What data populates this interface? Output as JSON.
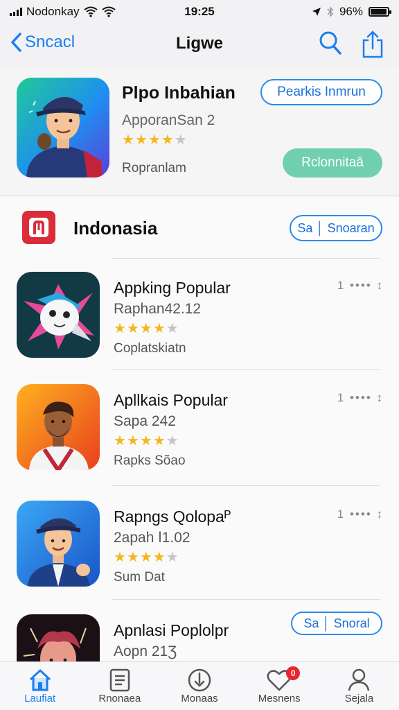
{
  "status_bar": {
    "carrier": "Nodonkay",
    "time": "19:25",
    "battery": "96%",
    "battery_level": 0.96,
    "icons": [
      "signal-icon",
      "wifi-icon",
      "wifi-icon",
      "location-icon",
      "bluetooth-icon",
      "battery-icon"
    ]
  },
  "nav": {
    "back_label": "Sncacl",
    "title": "Ligwe",
    "icons": [
      "search-icon",
      "share-icon"
    ]
  },
  "featured": {
    "name": "Plpo Inbahian",
    "subtitle": "ApporanSan 2",
    "rating": 4.5,
    "developer": "Ropranlam",
    "button_primary": "Pearkis Inmrun",
    "button_secondary": "Rclonnitaâ"
  },
  "section": {
    "title": "Indonasia",
    "button": "Sa │ Snoaran"
  },
  "apps": [
    {
      "name": "Appking Popular",
      "subtitle": "Raphan42.12",
      "rating": 4.5,
      "developer": "Coplatskiatn",
      "more": "1 •••• ↕"
    },
    {
      "name": "Apllkais Popular",
      "subtitle": "Sapa 242",
      "rating": 4.5,
      "developer": "Rapks Sõao",
      "more": "1 •••• ↕"
    },
    {
      "name": "Rapngs Qolopaᴾ",
      "subtitle": "2apah ǀ1.02",
      "rating": 4.5,
      "developer": "Sum Dat",
      "more": "1 •••• ↕"
    },
    {
      "name": "Apnlasi Poplolpr",
      "subtitle": "Aopn 21Ʒ",
      "button": "Sa │ Snoral"
    }
  ],
  "tabs": [
    {
      "label": "Laufiat",
      "icon": "home-icon",
      "active": true
    },
    {
      "label": "Rnonaea",
      "icon": "list-icon",
      "active": false
    },
    {
      "label": "Monaas",
      "icon": "compass-icon",
      "active": false
    },
    {
      "label": "Mesnens",
      "icon": "heart-icon",
      "active": false,
      "badge": "0"
    },
    {
      "label": "Sejala",
      "icon": "person-icon",
      "active": false
    }
  ],
  "colors": {
    "accent": "#1a7ef0",
    "install_green": "#6fcfae",
    "star": "#f4b71c",
    "badge_red": "#e8262e",
    "brand_red": "#d92d3a"
  }
}
